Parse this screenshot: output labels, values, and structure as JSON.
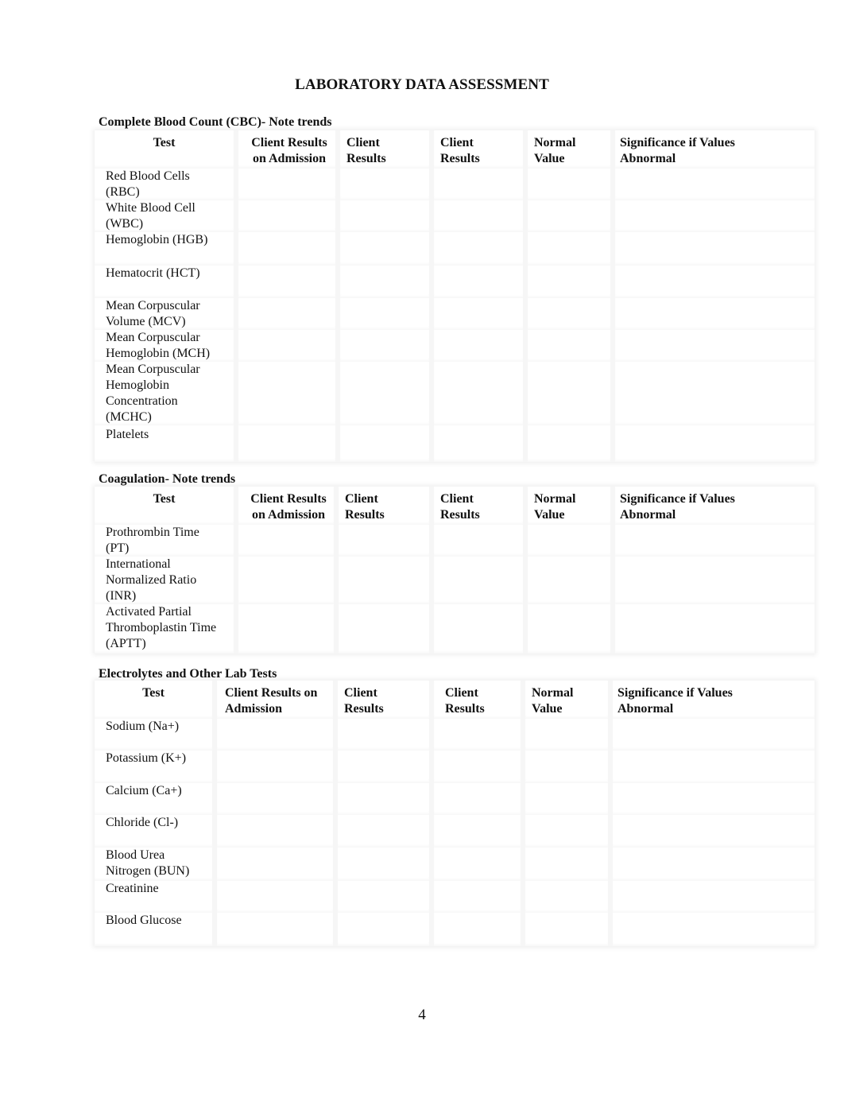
{
  "title": "LABORATORY DATA ASSESSMENT",
  "page_number": "4",
  "sections": [
    {
      "title": "Complete Blood Count (CBC)- Note trends",
      "headers": {
        "test": "Test",
        "admission": "Client Results on Admission",
        "results1": "Client Results",
        "results2": "Client Results",
        "normal": "Normal Value",
        "significance": "Significance if Values Abnormal"
      },
      "rows": [
        {
          "test": "Red Blood Cells (RBC)",
          "admission": "",
          "results1": "",
          "results2": "",
          "normal": "",
          "significance": ""
        },
        {
          "test": "White Blood Cell (WBC)",
          "admission": "",
          "results1": "",
          "results2": "",
          "normal": "",
          "significance": ""
        },
        {
          "test": "Hemoglobin (HGB)",
          "admission": "",
          "results1": "",
          "results2": "",
          "normal": "",
          "significance": ""
        },
        {
          "test": "Hematocrit (HCT)",
          "admission": "",
          "results1": "",
          "results2": "",
          "normal": "",
          "significance": ""
        },
        {
          "test": "Mean Corpuscular Volume (MCV)",
          "admission": "",
          "results1": "",
          "results2": "",
          "normal": "",
          "significance": ""
        },
        {
          "test": "Mean Corpuscular Hemoglobin (MCH)",
          "admission": "",
          "results1": "",
          "results2": "",
          "normal": "",
          "significance": ""
        },
        {
          "test": "Mean Corpuscular Hemoglobin Concentration (MCHC)",
          "admission": "",
          "results1": "",
          "results2": "",
          "normal": "",
          "significance": ""
        },
        {
          "test": "Platelets",
          "admission": "",
          "results1": "",
          "results2": "",
          "normal": "",
          "significance": ""
        }
      ]
    },
    {
      "title": "Coagulation- Note trends",
      "headers": {
        "test": "Test",
        "admission": "Client Results on Admission",
        "results1": "Client Results",
        "results2": "Client Results",
        "normal": "Normal Value",
        "significance": "Significance if Values Abnormal"
      },
      "rows": [
        {
          "test": "Prothrombin Time (PT)",
          "admission": "",
          "results1": "",
          "results2": "",
          "normal": "",
          "significance": ""
        },
        {
          "test": "International Normalized Ratio (INR)",
          "admission": "",
          "results1": "",
          "results2": "",
          "normal": "",
          "significance": ""
        },
        {
          "test": "Activated Partial Thromboplastin Time (APTT)",
          "admission": "",
          "results1": "",
          "results2": "",
          "normal": "",
          "significance": ""
        }
      ]
    },
    {
      "title": "Electrolytes and Other Lab Tests",
      "headers": {
        "test": "Test",
        "admission": "Client Results on Admission",
        "results1": "Client Results",
        "results2": "Client Results",
        "normal": "Normal Value",
        "significance": "Significance if Values Abnormal"
      },
      "rows": [
        {
          "test": "Sodium (Na+)",
          "admission": "",
          "results1": "",
          "results2": "",
          "normal": "",
          "significance": ""
        },
        {
          "test": "Potassium (K+)",
          "admission": "",
          "results1": "",
          "results2": "",
          "normal": "",
          "significance": ""
        },
        {
          "test": "Calcium (Ca+)",
          "admission": "",
          "results1": "",
          "results2": "",
          "normal": "",
          "significance": ""
        },
        {
          "test": "Chloride (Cl-)",
          "admission": "",
          "results1": "",
          "results2": "",
          "normal": "",
          "significance": ""
        },
        {
          "test": "Blood Urea Nitrogen (BUN)",
          "admission": "",
          "results1": "",
          "results2": "",
          "normal": "",
          "significance": ""
        },
        {
          "test": "Creatinine",
          "admission": "",
          "results1": "",
          "results2": "",
          "normal": "",
          "significance": ""
        },
        {
          "test": "Blood Glucose",
          "admission": "",
          "results1": "",
          "results2": "",
          "normal": "",
          "significance": ""
        }
      ]
    }
  ]
}
